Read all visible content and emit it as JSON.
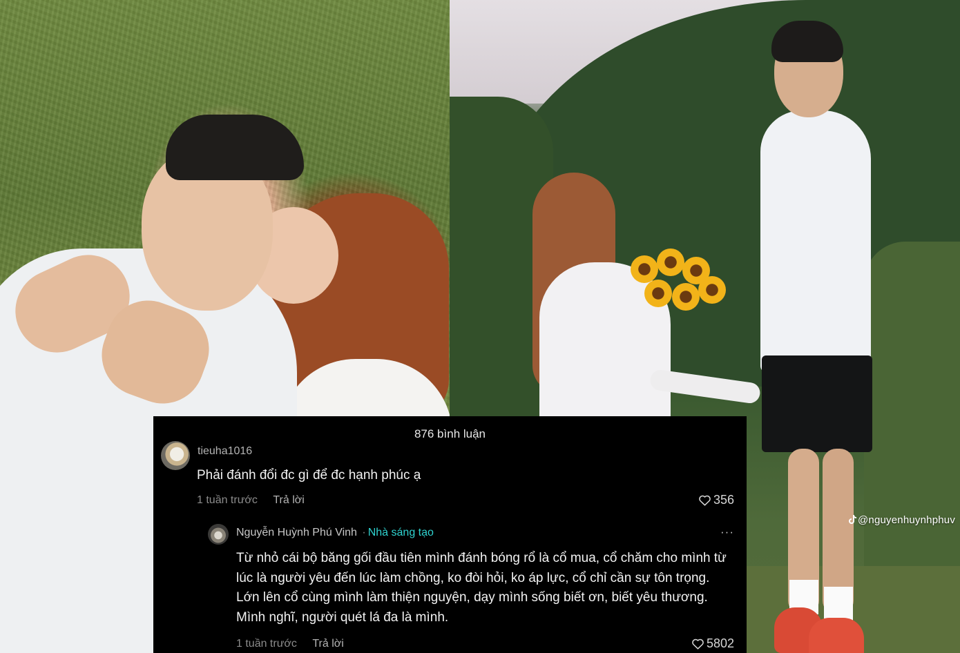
{
  "watermark": {
    "handle": "@nguyenhuynhphuv",
    "icon": "tiktok-icon"
  },
  "comments": {
    "count_label": "876 bình luận",
    "items": [
      {
        "username": "tieuha1016",
        "text": "Phải đánh đổi đc gì để đc hạnh phúc ạ",
        "time": "1 tuần trước",
        "reply_label": "Trả lời",
        "likes": "356"
      }
    ],
    "reply": {
      "username": "Nguyễn Huỳnh Phú Vinh",
      "separator": "·",
      "badge": "Nhà sáng tạo",
      "more": "···",
      "text": "Từ nhỏ cái bộ băng gối đầu tiên mình đánh bóng rổ là cổ mua, cổ chăm cho mình từ lúc là người yêu đến lúc làm chồng, ko đòi hỏi, ko áp lực, cổ chỉ cần sự tôn trọng. Lớn lên cổ cùng mình làm thiện nguyện, dạy mình sống biết ơn, biết yêu thương. Mình nghĩ, người quét lá đa là mình.",
      "time": "1 tuần trước",
      "reply_label": "Trả lời",
      "likes": "5802"
    }
  },
  "colors": {
    "creator_badge": "#2fd3d0",
    "panel_bg": "#000000"
  }
}
